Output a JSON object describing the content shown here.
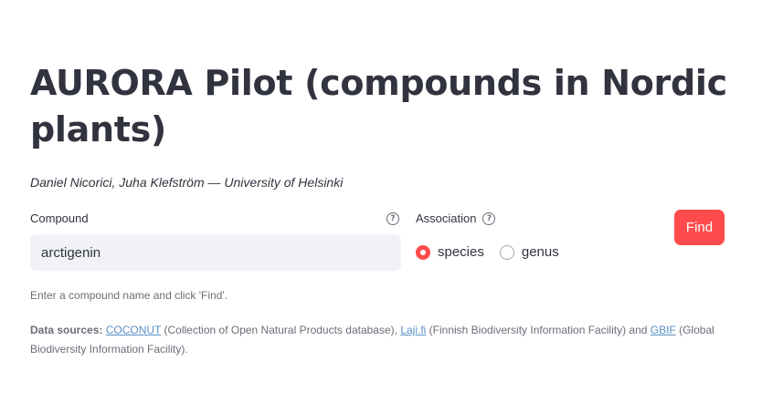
{
  "title": "AURORA Pilot (compounds in Nordic plants)",
  "authors": "Daniel Nicorici, Juha Klefström — University of Helsinki",
  "compound": {
    "label": "Compound",
    "value": "arctigenin",
    "help_icon": "question-circle-icon"
  },
  "association": {
    "label": "Association",
    "help_icon": "question-circle-icon",
    "options": [
      {
        "label": "species",
        "selected": true
      },
      {
        "label": "genus",
        "selected": false
      }
    ]
  },
  "find_button": "Find",
  "hint": "Enter a compound name and click 'Find'.",
  "sources": {
    "prefix": "Data sources:",
    "coconut_link": "COCONUT",
    "coconut_desc": " (Collection of Open Natural Products database), ",
    "laji_link": "Laji.fi",
    "laji_desc": " (Finnish Biodiversity Information Facility) and ",
    "gbif_link": "GBIF",
    "gbif_desc": " (Global Biodiversity Information Facility)."
  },
  "colors": {
    "accent": "#ff4b4b",
    "text": "#31333f",
    "muted": "#6b6d78",
    "link": "#5a8fc4",
    "input_bg": "#f0f2f6"
  }
}
